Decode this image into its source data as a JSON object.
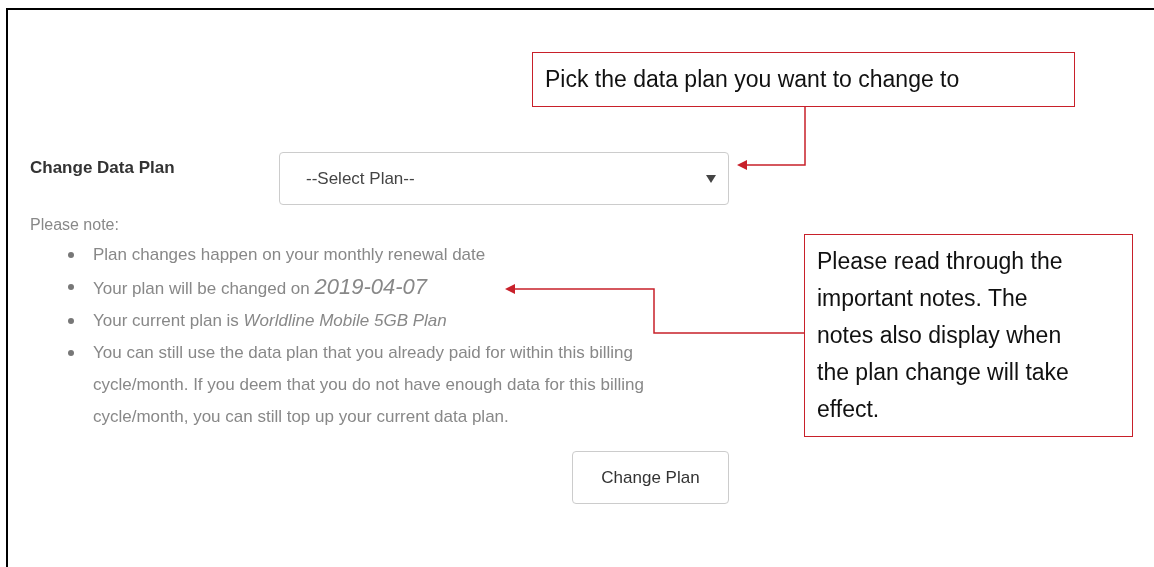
{
  "form": {
    "label": "Change Data Plan",
    "select": {
      "placeholder": "--Select Plan--"
    },
    "note_heading": "Please note:",
    "notes": [
      {
        "text": "Plan changes happen on your monthly renewal date"
      },
      {
        "text": "Your plan will be changed on",
        "date": "2019-04-07"
      },
      {
        "text": "Your current plan is *Worldline Mobile 5GB Plan*"
      },
      {
        "text": "You can still use the data plan that you already paid for within this billing cycle/month. If you deem that you do not have enough data for this billing cycle/month, you can still top up your current data plan."
      }
    ],
    "button": "Change Plan"
  },
  "callouts": [
    {
      "text": "Pick the data plan you want to change to"
    },
    {
      "text": "Please read through the important notes. The notes also display when the plan change will take effect."
    }
  ]
}
